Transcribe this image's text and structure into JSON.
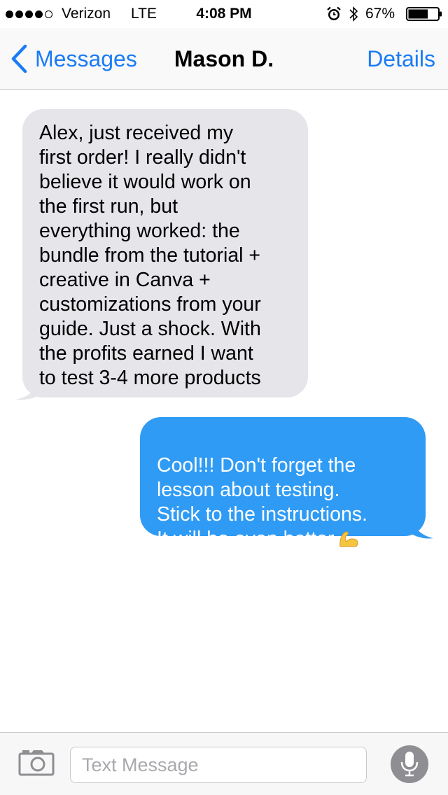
{
  "status_bar": {
    "carrier": "Verizon",
    "network": "LTE",
    "time": "4:08 PM",
    "battery_percent": "67%",
    "battery_level": 0.67,
    "signal_bars_filled": 4,
    "signal_bars_total": 5,
    "icons": [
      "alarm-icon",
      "bluetooth-icon",
      "battery-icon"
    ]
  },
  "nav": {
    "back_label": "Messages",
    "title": "Mason D.",
    "details_label": "Details",
    "accent_color": "#1a7cf4"
  },
  "messages": [
    {
      "direction": "incoming",
      "text": "Alex, just received my\nfirst order! I really didn't\nbelieve it would work on\nthe first run, but\neverything worked: the\nbundle from the tutorial +\ncreative in Canva +\ncustomizations from your\nguide. Just a shock. With\nthe profits earned I want\nto test 3-4 more products",
      "bubble_color": "#e5e5ea"
    },
    {
      "direction": "outgoing",
      "text": "Cool!!! Don't forget the\nlesson about testing.\nStick to the instructions.\nIt will be even better",
      "emoji": "flexed-biceps-emoji",
      "bubble_color": "#2f9bf5"
    }
  ],
  "composer": {
    "placeholder": "Text Message",
    "value": "",
    "icons": [
      "camera-icon",
      "microphone-icon"
    ]
  }
}
